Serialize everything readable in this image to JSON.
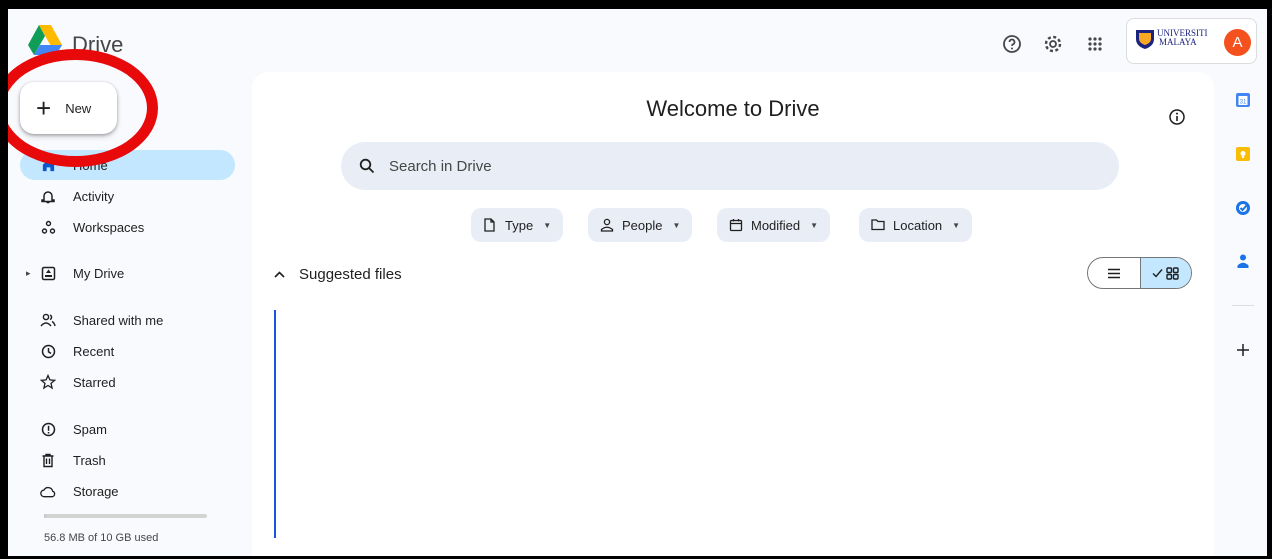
{
  "header": {
    "app_title": "Drive",
    "account": {
      "org_line1": "UNIVERSITI",
      "org_line2": "MALAYA",
      "avatar_letter": "A"
    }
  },
  "sidebar": {
    "new_label": "New",
    "items": [
      {
        "label": "Home",
        "icon": "home-icon"
      },
      {
        "label": "Activity",
        "icon": "bell-icon"
      },
      {
        "label": "Workspaces",
        "icon": "workspaces-icon"
      },
      {
        "label": "My Drive",
        "icon": "drive-icon"
      },
      {
        "label": "Shared with me",
        "icon": "people-icon"
      },
      {
        "label": "Recent",
        "icon": "clock-icon"
      },
      {
        "label": "Starred",
        "icon": "star-icon"
      },
      {
        "label": "Spam",
        "icon": "spam-icon"
      },
      {
        "label": "Trash",
        "icon": "trash-icon"
      },
      {
        "label": "Storage",
        "icon": "cloud-icon"
      }
    ],
    "storage": {
      "text": "56.8 MB of 10 GB used",
      "used_fraction": 0.0057
    }
  },
  "main": {
    "welcome": "Welcome to Drive",
    "search_placeholder": "Search in Drive",
    "filters": [
      "Type",
      "People",
      "Modified",
      "Location"
    ],
    "suggested_title": "Suggested files",
    "view_mode": "grid"
  },
  "colors": {
    "accent": "#c2e7ff",
    "avatar": "#f4511e",
    "annotation_circle": "#e8090b"
  }
}
